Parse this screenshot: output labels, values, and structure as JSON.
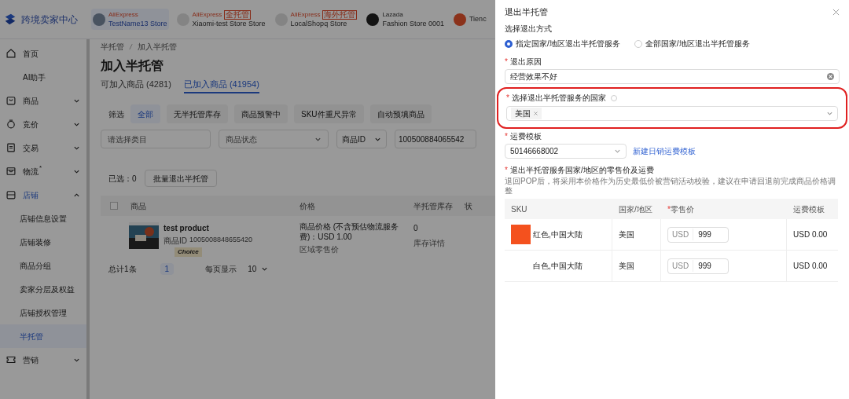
{
  "header": {
    "logo_text": "跨境卖家中心",
    "stores": [
      {
        "platform": "AliExpress",
        "name": "TestName13 Store",
        "selected": true
      },
      {
        "platform": "AliExpress",
        "tag": "全托管",
        "name": "Xiaomi-test Store Store",
        "selected": false
      },
      {
        "platform": "AliExpress",
        "tag": "海外托管",
        "name": "LocalShopq Store",
        "selected": false
      },
      {
        "platform": "Lazada",
        "name": "Fashion Store 0001",
        "selected": false
      },
      {
        "name": "Tienc",
        "selected": false
      }
    ]
  },
  "sidebar": {
    "items": [
      {
        "label": "首页",
        "selected": false
      },
      {
        "label": "AI助手",
        "selected": false
      },
      {
        "label": "商品",
        "expanded": false,
        "selected": false
      },
      {
        "label": "竞价",
        "expanded": false,
        "selected": false
      },
      {
        "label": "交易",
        "expanded": false,
        "selected": false
      },
      {
        "label": "物流",
        "badge": "*",
        "expanded": false,
        "selected": false
      },
      {
        "label": "店铺",
        "expanded": true,
        "selected": false,
        "children": [
          {
            "label": "店铺信息设置",
            "selected": false
          },
          {
            "label": "店铺装修",
            "selected": false
          },
          {
            "label": "商品分组",
            "selected": false
          },
          {
            "label": "卖家分层及权益",
            "selected": false
          },
          {
            "label": "店铺授权管理",
            "selected": false
          },
          {
            "label": "半托管",
            "selected": true
          }
        ]
      },
      {
        "label": "营销",
        "expanded": false,
        "selected": false
      }
    ]
  },
  "main": {
    "breadcrumb": [
      "半托管",
      "加入半托管"
    ],
    "title": "加入半托管",
    "tabs": [
      {
        "label": "可加入商品",
        "count": "(4281)",
        "selected": false
      },
      {
        "label": "已加入商品",
        "count": "(41954)",
        "selected": true
      }
    ],
    "filter_label": "筛选",
    "filters": [
      {
        "label": "全部",
        "selected": true
      },
      {
        "label": "无半托管库存",
        "selected": false
      },
      {
        "label": "商品预警中",
        "selected": false
      },
      {
        "label": "SKU件重尺异常",
        "selected": false
      },
      {
        "label": "自动预填商品",
        "selected": false
      }
    ],
    "category_placeholder": "请选择类目",
    "status_placeholder": "商品状态",
    "id_type": "商品ID",
    "id_value": "100500884065542",
    "selected_count": "已选：0",
    "batch_button": "批量退出半托管",
    "table": {
      "select_all_checked": false,
      "columns": [
        "商品",
        "价格",
        "半托管库存",
        "状"
      ],
      "rows": [
        {
          "product": "test product",
          "id_label": "商品ID",
          "id": "1005008848655420",
          "badge": "Choice",
          "price": "商品价格 (不含预估物流服务费)：USD 1.00",
          "region_price": "区域零售价",
          "stock": "0",
          "stock_detail": "库存详情"
        }
      ]
    },
    "pagination": {
      "total": "总计1条",
      "page": "1",
      "per_page_label": "每页显示",
      "per_page": "10"
    }
  },
  "drawer": {
    "title": "退出半托管",
    "method_label": "选择退出方式",
    "methods": [
      {
        "label": "指定国家/地区退出半托管服务",
        "selected": true
      },
      {
        "label": "全部国家/地区退出半托管服务",
        "selected": false
      }
    ],
    "reason_label": "退出原因",
    "reason_value": "经营效果不好",
    "country_label": "选择退出半托管服务的国家",
    "countries": [
      "美国"
    ],
    "highlighted": true,
    "template_label": "运费模板",
    "template_value": "50146668002",
    "template_link": "新建日销运费模板",
    "price_label": "退出半托管服务国家/地区的零售价及运费",
    "price_hint": "退回POP后，将采用本价格作为历史最低价被营销活动校验，建议在申请回退前完成商品价格调整",
    "sku_table": {
      "columns": [
        {
          "label": "SKU",
          "required": false
        },
        {
          "label": "国家/地区",
          "required": false
        },
        {
          "label": "零售价",
          "required": true
        },
        {
          "label": "运费模板",
          "required": false
        }
      ],
      "rows": [
        {
          "sku": "红色,中国大陆",
          "color": "#f4511e",
          "country": "美国",
          "currency": "USD",
          "price": "999",
          "shipping": "USD 0.00"
        },
        {
          "sku": "白色,中国大陆",
          "country": "美国",
          "currency": "USD",
          "price": "999",
          "shipping": "USD 0.00"
        }
      ]
    }
  }
}
